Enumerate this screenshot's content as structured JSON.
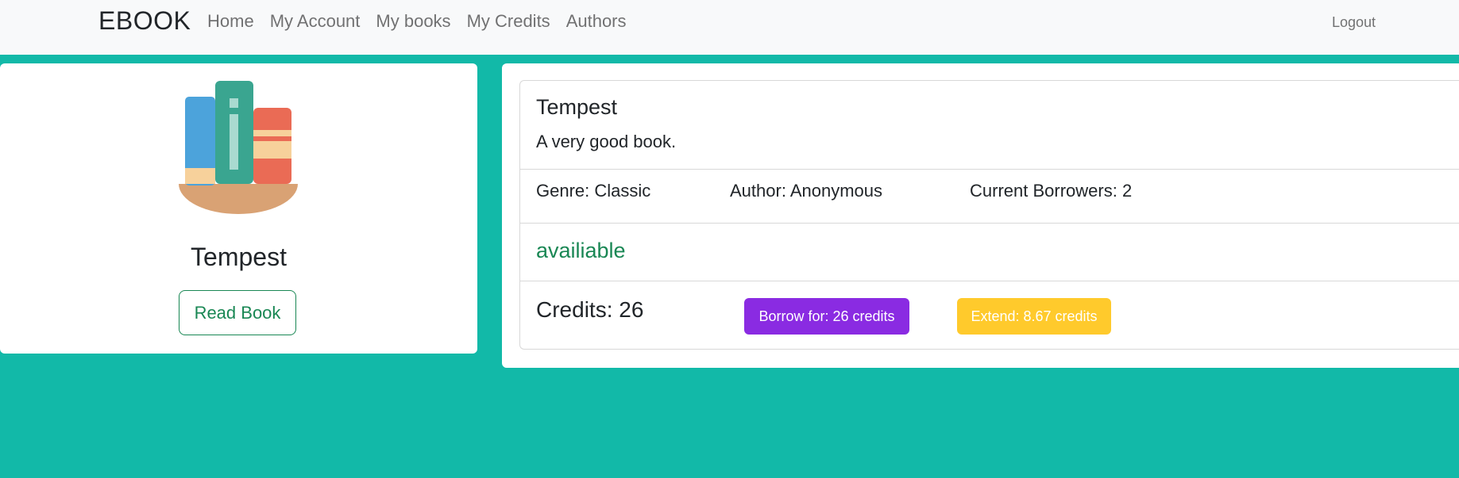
{
  "navbar": {
    "brand": "EBOOK",
    "links": [
      "Home",
      "My Account",
      "My books",
      "My Credits",
      "Authors"
    ],
    "logout": "Logout"
  },
  "book_card": {
    "icon": "books-shelf-icon",
    "title": "Tempest",
    "read_button": "Read Book"
  },
  "details": {
    "title": "Tempest",
    "description": "A very good book.",
    "genre": "Genre: Classic",
    "author": "Author: Anonymous",
    "borrowers": "Current Borrowers: 2",
    "status": "availiable",
    "credits": "Credits: 26",
    "borrow_button": "Borrow for: 26 credits",
    "extend_button": "Extend: 8.67 credits"
  },
  "colors": {
    "background": "#12b9a8",
    "navbar": "#f8f9fa",
    "status_green": "#198754",
    "borrow": "#8a2be2",
    "extend": "#ffca2c"
  }
}
